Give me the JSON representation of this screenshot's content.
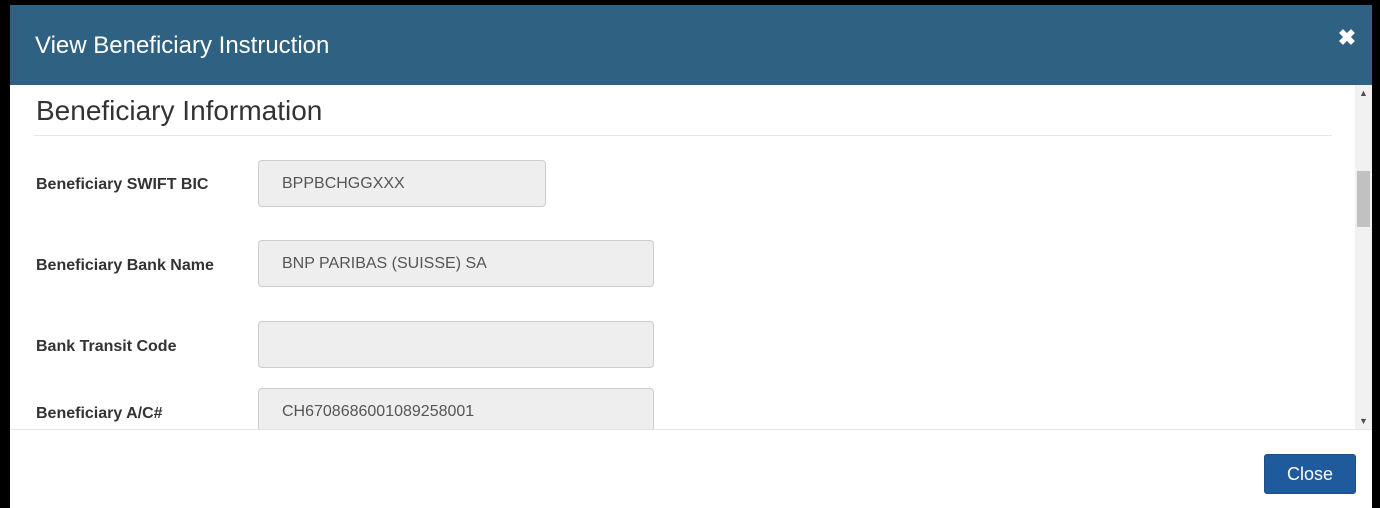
{
  "modal": {
    "title": "View Beneficiary Instruction",
    "close_icon": "close-icon"
  },
  "section": {
    "title": "Beneficiary Information"
  },
  "fields": [
    {
      "label": "Beneficiary SWIFT BIC",
      "value": "BPPBCHGGXXX"
    },
    {
      "label": "Beneficiary Bank Name",
      "value": "BNP PARIBAS (SUISSE) SA"
    },
    {
      "label": "Bank Transit Code",
      "value": ""
    },
    {
      "label": "Beneficiary A/C#",
      "value": "CH6708686001089258001"
    }
  ],
  "footer": {
    "close_label": "Close"
  },
  "colors": {
    "header_bg": "#2e6182",
    "button_bg": "#1f5b9c",
    "input_bg": "#eeeeee"
  }
}
